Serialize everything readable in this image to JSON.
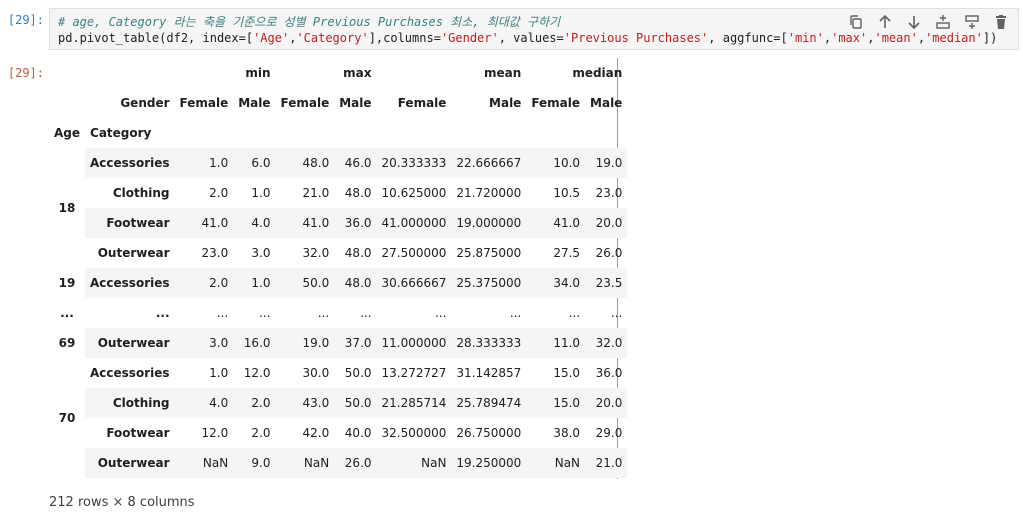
{
  "input_prompt": "[29]:",
  "output_prompt": "[29]:",
  "code": {
    "comment": "# age, Category 라는 축을 기준으로 성별 Previous Purchases 최소, 최대값 구하기",
    "line2_a": "pd.pivot_table(df2, index=[",
    "age_str": "'Age'",
    "comma1": ",",
    "cat_str": "'Category'",
    "line2_b": "],columns=",
    "gender_str": "'Gender'",
    "line2_c": ", values=",
    "pp_str": "'Previous Purchases'",
    "line2_d": ", aggfunc=[",
    "min_str": "'min'",
    "comma2": ",",
    "max_str": "'max'",
    "comma3": ",",
    "mean_str": "'mean'",
    "comma4": ",",
    "median_str": "'median'",
    "line2_e": "])"
  },
  "toolbar": {
    "icons": [
      "copy-icon",
      "move-up-icon",
      "move-down-icon",
      "insert-above-icon",
      "insert-below-icon",
      "delete-icon"
    ]
  },
  "table": {
    "agg_headers": [
      "min",
      "max",
      "mean",
      "median"
    ],
    "gender_label": "Gender",
    "genders": [
      "Female",
      "Male",
      "Female",
      "Male",
      "Female",
      "Male",
      "Female",
      "Male"
    ],
    "index_names": [
      "Age",
      "Category"
    ],
    "rows": [
      {
        "age": "18",
        "category": "Accessories",
        "values": [
          "1.0",
          "6.0",
          "48.0",
          "46.0",
          "20.333333",
          "22.666667",
          "10.0",
          "19.0"
        ]
      },
      {
        "age": "",
        "category": "Clothing",
        "values": [
          "2.0",
          "1.0",
          "21.0",
          "48.0",
          "10.625000",
          "21.720000",
          "10.5",
          "23.0"
        ]
      },
      {
        "age": "",
        "category": "Footwear",
        "values": [
          "41.0",
          "4.0",
          "41.0",
          "36.0",
          "41.000000",
          "19.000000",
          "41.0",
          "20.0"
        ]
      },
      {
        "age": "",
        "category": "Outerwear",
        "values": [
          "23.0",
          "3.0",
          "32.0",
          "48.0",
          "27.500000",
          "25.875000",
          "27.5",
          "26.0"
        ]
      },
      {
        "age": "19",
        "category": "Accessories",
        "values": [
          "2.0",
          "1.0",
          "50.0",
          "48.0",
          "30.666667",
          "25.375000",
          "34.0",
          "23.5"
        ]
      },
      {
        "age": "...",
        "category": "...",
        "values": [
          "...",
          "...",
          "...",
          "...",
          "...",
          "...",
          "...",
          "..."
        ]
      },
      {
        "age": "69",
        "category": "Outerwear",
        "values": [
          "3.0",
          "16.0",
          "19.0",
          "37.0",
          "11.000000",
          "28.333333",
          "11.0",
          "32.0"
        ]
      },
      {
        "age": "70",
        "category": "Accessories",
        "values": [
          "1.0",
          "12.0",
          "30.0",
          "50.0",
          "13.272727",
          "31.142857",
          "15.0",
          "36.0"
        ]
      },
      {
        "age": "",
        "category": "Clothing",
        "values": [
          "4.0",
          "2.0",
          "43.0",
          "50.0",
          "21.285714",
          "25.789474",
          "15.0",
          "20.0"
        ]
      },
      {
        "age": "",
        "category": "Footwear",
        "values": [
          "12.0",
          "2.0",
          "42.0",
          "40.0",
          "32.500000",
          "26.750000",
          "38.0",
          "29.0"
        ]
      },
      {
        "age": "",
        "category": "Outerwear",
        "values": [
          "NaN",
          "9.0",
          "NaN",
          "26.0",
          "NaN",
          "19.250000",
          "NaN",
          "21.0"
        ]
      }
    ]
  },
  "footer": "212 rows × 8 columns"
}
